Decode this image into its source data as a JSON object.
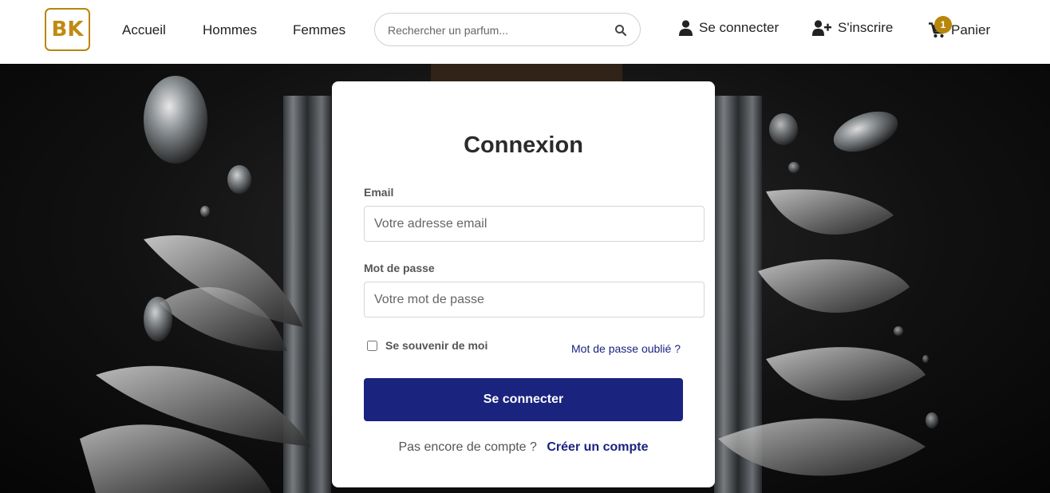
{
  "brand": {
    "logo_text": "BK",
    "accent": "#b8860b"
  },
  "nav": {
    "items": [
      {
        "label": "Accueil"
      },
      {
        "label": "Hommes"
      },
      {
        "label": "Femmes"
      }
    ]
  },
  "search": {
    "placeholder": "Rechercher un parfum...",
    "icon": "search-icon"
  },
  "header_actions": {
    "login_label": "Se connecter",
    "register_label": "S'inscrire",
    "cart_label": "Panier",
    "cart_count": "1"
  },
  "login": {
    "title": "Connexion",
    "email_label": "Email",
    "email_placeholder": "Votre adresse email",
    "password_label": "Mot de passe",
    "password_placeholder": "Votre mot de passe",
    "remember_label": "Se souvenir de moi",
    "forgot_label": "Mot de passe oublié ?",
    "submit_label": "Se connecter",
    "no_account_text": "Pas encore de compte ?",
    "create_account_label": "Créer un compte",
    "primary_color": "#1a237e"
  }
}
